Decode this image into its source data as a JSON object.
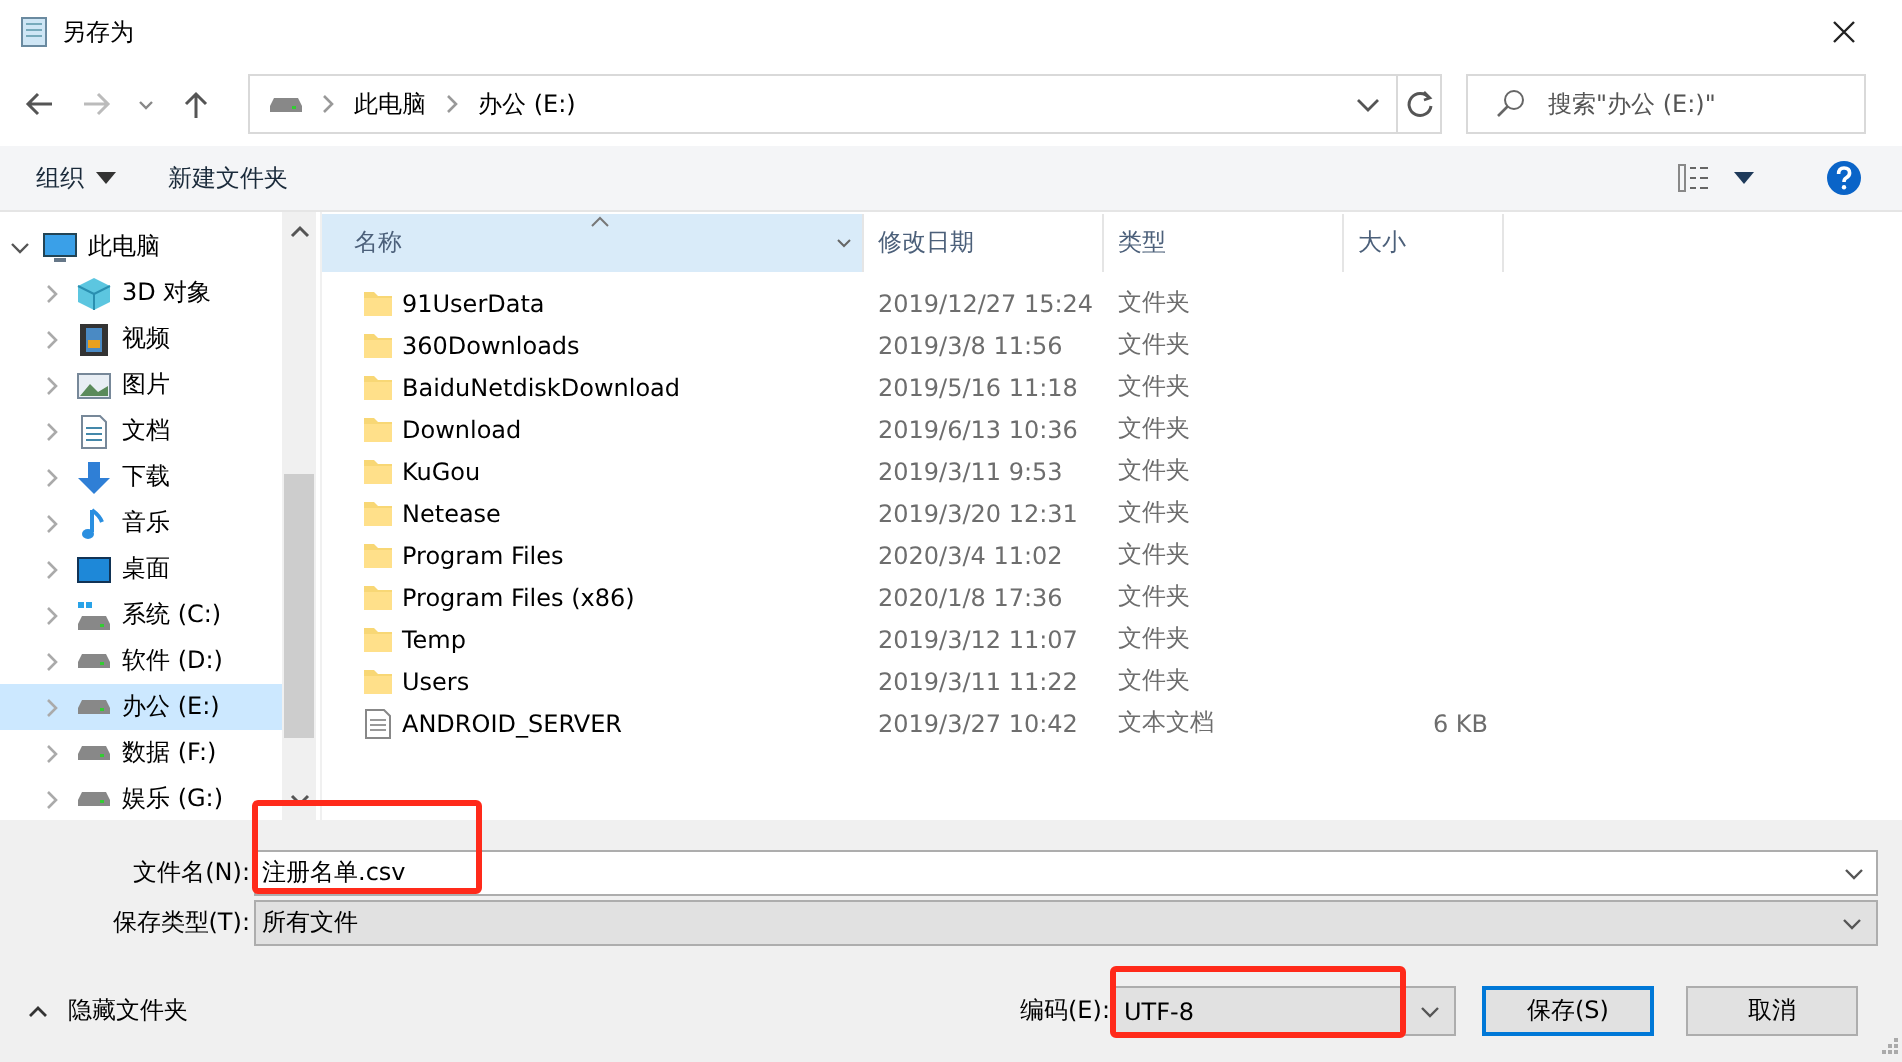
{
  "window": {
    "title": "另存为"
  },
  "address": {
    "path": [
      "此电脑",
      "办公 (E:)"
    ],
    "search_placeholder": "搜索\"办公 (E:)\""
  },
  "toolbar": {
    "organize": "组织",
    "new_folder": "新建文件夹"
  },
  "tree": [
    {
      "label": "此电脑",
      "kind": "pc",
      "expanded": true,
      "selected": false,
      "children": [
        {
          "label": "3D 对象",
          "kind": "cube",
          "expanded": false,
          "selected": false
        },
        {
          "label": "视频",
          "kind": "video",
          "expanded": false,
          "selected": false
        },
        {
          "label": "图片",
          "kind": "picture",
          "expanded": false,
          "selected": false
        },
        {
          "label": "文档",
          "kind": "document",
          "expanded": false,
          "selected": false
        },
        {
          "label": "下载",
          "kind": "download",
          "expanded": false,
          "selected": false
        },
        {
          "label": "音乐",
          "kind": "music",
          "expanded": false,
          "selected": false
        },
        {
          "label": "桌面",
          "kind": "desktop",
          "expanded": false,
          "selected": false
        },
        {
          "label": "系统 (C:)",
          "kind": "sysdrive",
          "expanded": false,
          "selected": false
        },
        {
          "label": "软件 (D:)",
          "kind": "drive",
          "expanded": false,
          "selected": false
        },
        {
          "label": "办公 (E:)",
          "kind": "drive",
          "expanded": false,
          "selected": true
        },
        {
          "label": "数据 (F:)",
          "kind": "drive",
          "expanded": false,
          "selected": false
        },
        {
          "label": "娱乐 (G:)",
          "kind": "drive",
          "expanded": false,
          "selected": false
        }
      ]
    }
  ],
  "columns": [
    {
      "label": "名称",
      "sorted": true
    },
    {
      "label": "修改日期",
      "sorted": false
    },
    {
      "label": "类型",
      "sorted": false
    },
    {
      "label": "大小",
      "sorted": false
    }
  ],
  "files": [
    {
      "name": "91UserData",
      "modified": "2019/12/27 15:24",
      "type": "文件夹",
      "kind": "folder"
    },
    {
      "name": "360Downloads",
      "modified": "2019/3/8 11:56",
      "type": "文件夹",
      "kind": "folder"
    },
    {
      "name": "BaiduNetdiskDownload",
      "modified": "2019/5/16 11:18",
      "type": "文件夹",
      "kind": "folder"
    },
    {
      "name": "Download",
      "modified": "2019/6/13 10:36",
      "type": "文件夹",
      "kind": "folder"
    },
    {
      "name": "KuGou",
      "modified": "2019/3/11 9:53",
      "type": "文件夹",
      "kind": "folder"
    },
    {
      "name": "Netease",
      "modified": "2019/3/20 12:31",
      "type": "文件夹",
      "kind": "folder"
    },
    {
      "name": "Program Files",
      "modified": "2020/3/4 11:02",
      "type": "文件夹",
      "kind": "folder"
    },
    {
      "name": "Program Files (x86)",
      "modified": "2020/1/8 17:36",
      "type": "文件夹",
      "kind": "folder"
    },
    {
      "name": "Temp",
      "modified": "2019/3/12 11:07",
      "type": "文件夹",
      "kind": "folder"
    },
    {
      "name": "Users",
      "modified": "2019/3/11 11:22",
      "type": "文件夹",
      "kind": "folder"
    },
    {
      "name": "ANDROID_SERVER",
      "modified": "2019/3/27 10:42",
      "type": "文本文档",
      "size": "6 KB",
      "kind": "file"
    }
  ],
  "footer": {
    "filename_label": "文件名(N):",
    "filename": "注册名单.csv",
    "type_label": "保存类型(T):",
    "type": "所有文件",
    "hide_folders": "隐藏文件夹",
    "encoding_label": "编码(E):",
    "encoding": "UTF-8",
    "save": "保存(S)",
    "cancel": "取消"
  },
  "annotations": [
    {
      "color": "#ff2a1a"
    },
    {
      "color": "#ff2a1a"
    }
  ]
}
